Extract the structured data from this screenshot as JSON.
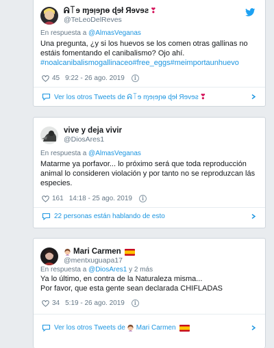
{
  "tweets": [
    {
      "display_name": "ᕱ꓄ɘ ɱɘı̣ɘɲɵ ɖɘł Яɘvɘƨ",
      "name_emoji": "❣",
      "handle": "@TeLeoDelReves",
      "reply_prefix": "En respuesta a ",
      "reply_mention": "@AlmasVeganas",
      "reply_suffix": "",
      "text": "Una pregunta, ¿y si los huevos se los comen otras gallinas no estáis fomentando el canibalismo? Ojo ahí.",
      "hashtags": "#noalcanibalismogallinaceo#free_eggs#meimportaunhuevo",
      "likes": "45",
      "timestamp": "9:22 - 26 ago. 2019",
      "footer_text": "Ver los otros Tweets de ᕱ꓄ɘ ɱɘı̣ɘɲɵ ɖɘł Яɘvɘƨ"
    },
    {
      "display_name": "vive y deja vivir",
      "handle": "@DiosAres1",
      "reply_prefix": "En respuesta a ",
      "reply_mention": "@AlmasVeganas",
      "reply_suffix": "",
      "text": "Matarme ya porfavor... lo próximo será que toda reproducción animal lo consideren violación y por tanto no se reproduzcan lás especies.",
      "likes": "161",
      "timestamp": "14:18 - 25 ago. 2019",
      "footer_text": "22 personas están hablando de esto"
    },
    {
      "display_name": "Mari Carmen",
      "handle": "@mentxuguapa17",
      "reply_prefix": "En respuesta a ",
      "reply_mention": "@DiosAres1",
      "reply_suffix": " y 2 más",
      "text_line1": "Ya lo último, en contra de la Naturaleza misma...",
      "text_line2": "Por favor, que esta gente sean declarada CHIFLADAS",
      "likes": "34",
      "timestamp": "5:19 - 26 ago. 2019",
      "footer_prefix": "Ver los otros Tweets de ",
      "footer_name": "Mari Carmen"
    }
  ],
  "colors": {
    "link": "#1b95e0",
    "muted": "#657786",
    "twitter_blue": "#1da1f2",
    "page_bg": "#e9ecef"
  },
  "icons": [
    "avatar",
    "twitter-bird-icon",
    "heart-icon",
    "info-icon",
    "conversation-icon",
    "chevron-right-icon",
    "spain-flag-icon",
    "woman-emoji-icon"
  ]
}
